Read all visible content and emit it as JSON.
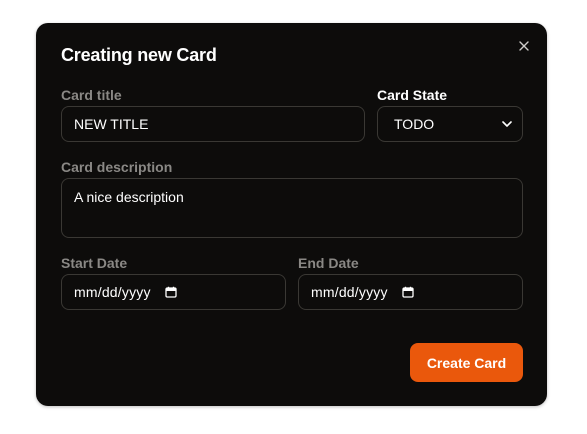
{
  "modal": {
    "title": "Creating new Card",
    "close_icon": "close-icon"
  },
  "form": {
    "card_title": {
      "label": "Card title",
      "value": "NEW TITLE"
    },
    "card_state": {
      "label": "Card State",
      "value": "TODO",
      "icon": "chevron-down-icon"
    },
    "card_description": {
      "label": "Card description",
      "value": "A nice description"
    },
    "start_date": {
      "label": "Start Date",
      "value": "mm/dd/yyyy",
      "icon": "calendar-icon"
    },
    "end_date": {
      "label": "End Date",
      "value": "mm/dd/yyyy",
      "icon": "calendar-icon"
    }
  },
  "actions": {
    "create_label": "Create Card"
  },
  "colors": {
    "background": "#0d0c0b",
    "border": "#3a3834",
    "muted_label": "#8a8885",
    "accent": "#ea580c"
  }
}
